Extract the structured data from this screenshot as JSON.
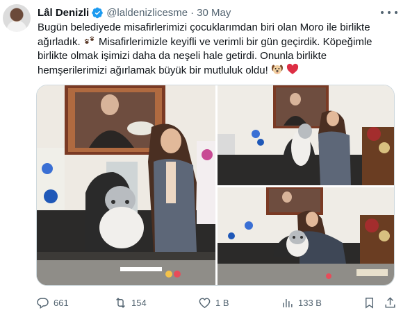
{
  "tweet": {
    "author_name": "Lâl Denizli",
    "handle": "@laldenizlicesme",
    "separator": "·",
    "date": "30 May",
    "text_lines": [
      "Bugün belediyede misafirlerimizi çocuklarımdan biri olan Moro ile birlikte",
      "ağırladık.",
      "Misafirlerimizle  keyifli ve verimli bir gün geçirdik. Köpeğimle",
      "birlikte olmak işimizi daha da neşeli hale getirdi. Onunla birlikte",
      "hemşerilerimizi ağırlamak büyük bir mutluluk oldu!"
    ],
    "emojis": [
      "paw-prints",
      "dog-face",
      "red-heart"
    ]
  },
  "colors": {
    "text": "#0f1419",
    "secondary": "#536471",
    "verified_blue": "#1d9bf0",
    "heart_red": "#e0245e",
    "border": "#cfd9de"
  },
  "actions": {
    "replies": "661",
    "reposts": "154",
    "likes": "1 B",
    "views": "133 B"
  },
  "icons": [
    "verified-badge-icon",
    "more-icon",
    "reply-icon",
    "repost-icon",
    "like-icon",
    "views-icon",
    "bookmark-icon",
    "share-icon"
  ]
}
